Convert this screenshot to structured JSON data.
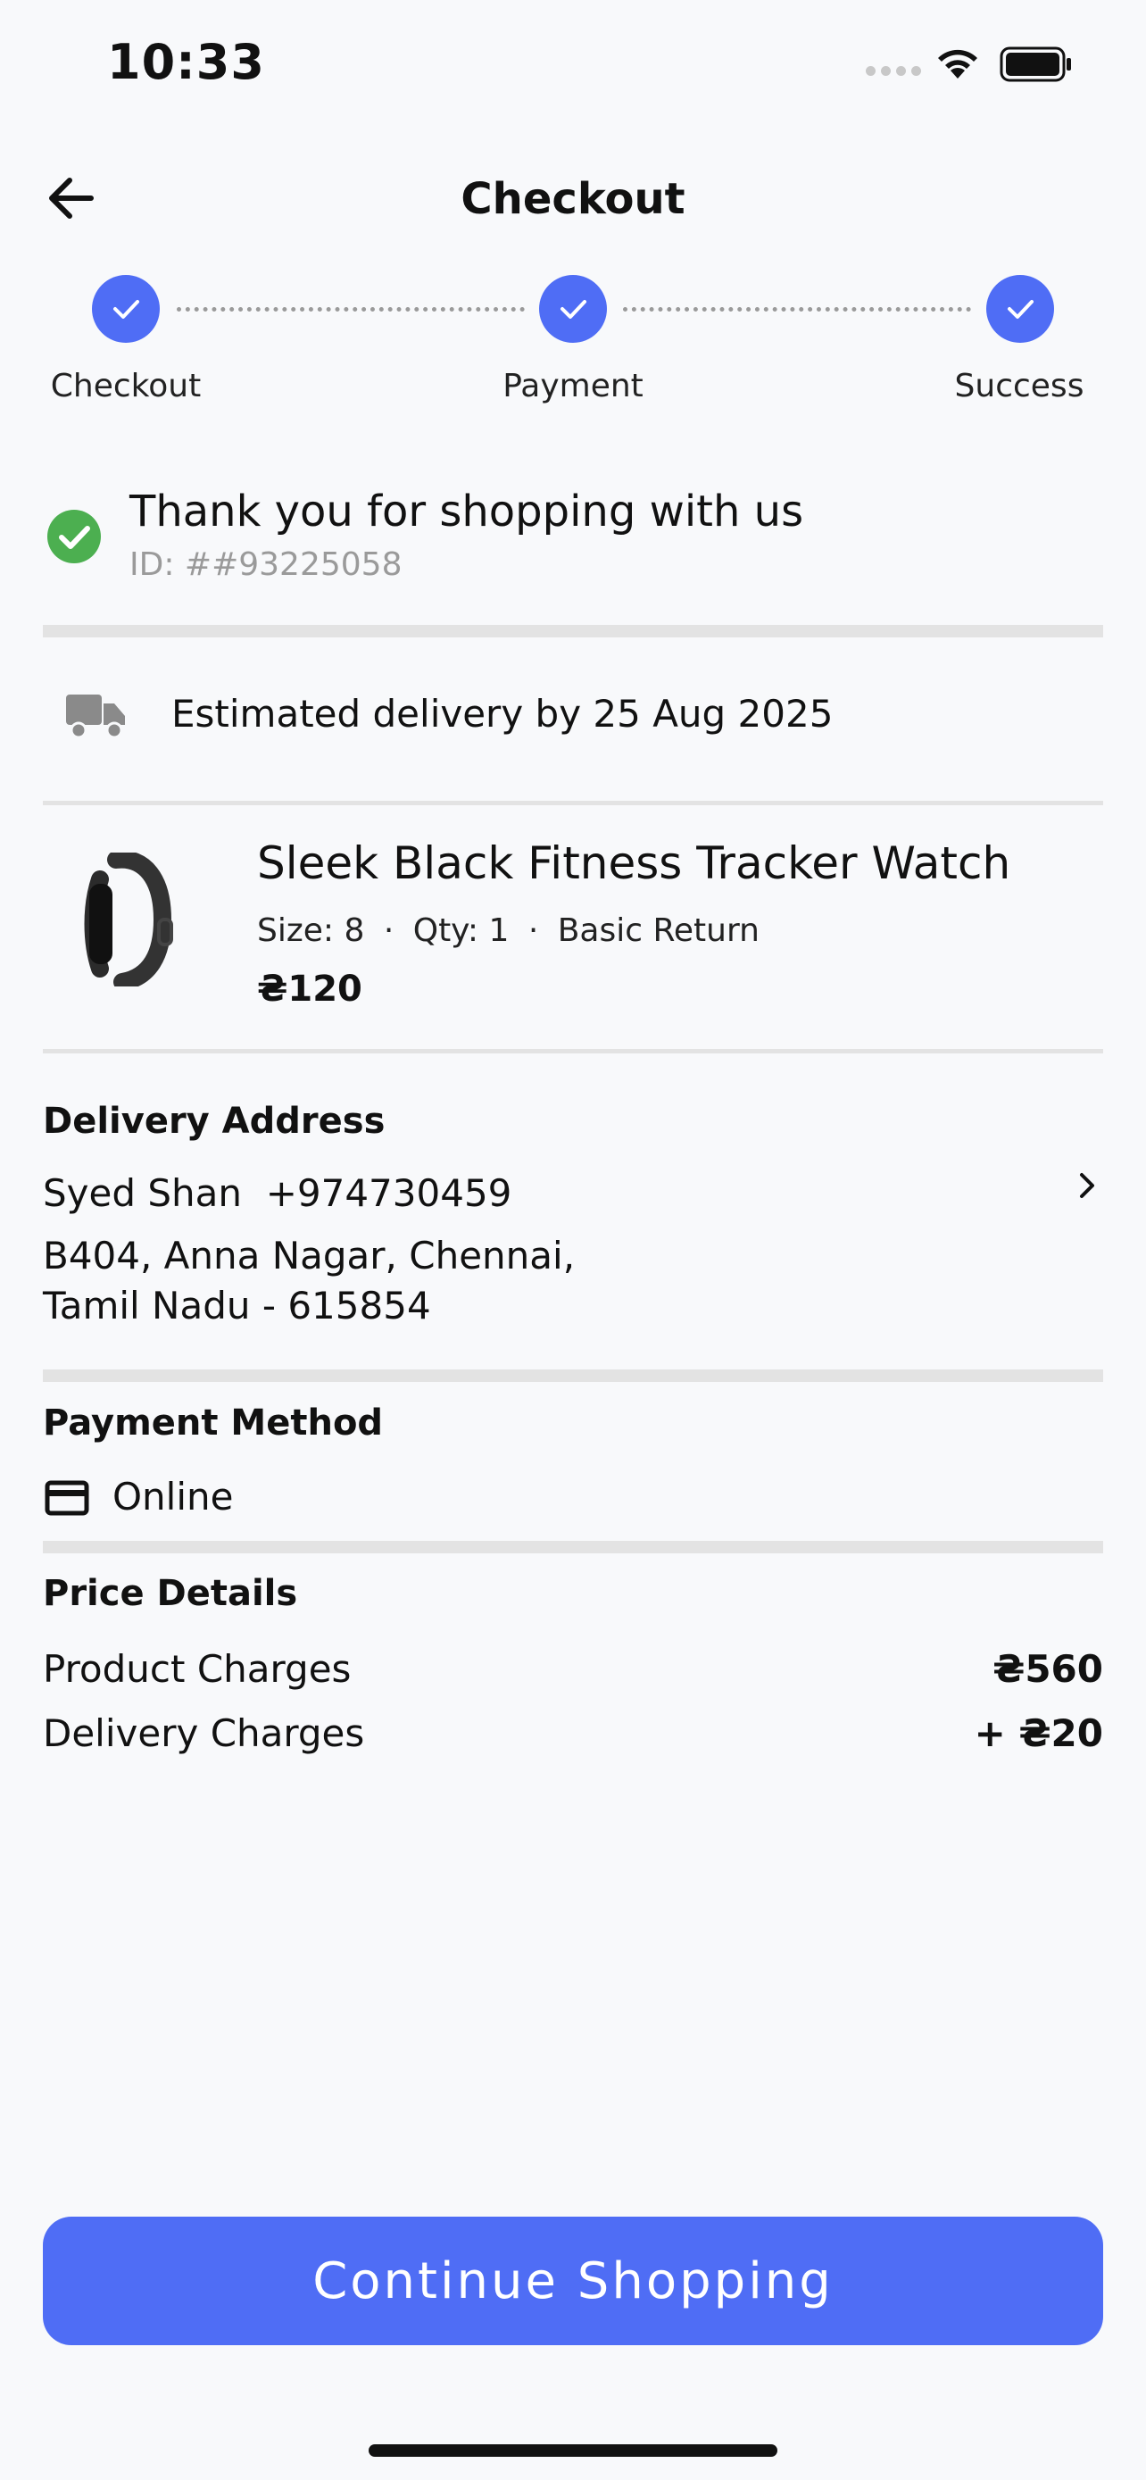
{
  "status_bar": {
    "time": "10:33"
  },
  "header": {
    "title": "Checkout"
  },
  "stepper": {
    "steps": [
      {
        "label": "Checkout"
      },
      {
        "label": "Payment"
      },
      {
        "label": "Success"
      }
    ]
  },
  "confirmation": {
    "title": "Thank you for shopping with us",
    "order_id": "ID: ##93225058"
  },
  "delivery": {
    "estimate": "Estimated delivery by 25 Aug 2025"
  },
  "product": {
    "name": "Sleek Black Fitness Tracker Watch",
    "size": "Size: 8",
    "qty": "Qty: 1",
    "return_policy": "Basic Return",
    "separator": "·",
    "price": "₴120"
  },
  "address": {
    "title": "Delivery Address",
    "name_phone": "Syed Shan  +974730459",
    "line1": "B404, Anna Nagar, Chennai,",
    "line2": "Tamil Nadu - 615854"
  },
  "payment": {
    "title": "Payment Method",
    "method": "Online"
  },
  "price_details": {
    "title": "Price Details",
    "rows": [
      {
        "label": "Product Charges",
        "value": "₴560"
      },
      {
        "label": "Delivery Charges",
        "value": "+ ₴20"
      }
    ]
  },
  "cta": {
    "label": "Continue Shopping"
  },
  "colors": {
    "accent": "#4f6df5",
    "success": "#4caf50",
    "divider": "#e3e3e3"
  }
}
